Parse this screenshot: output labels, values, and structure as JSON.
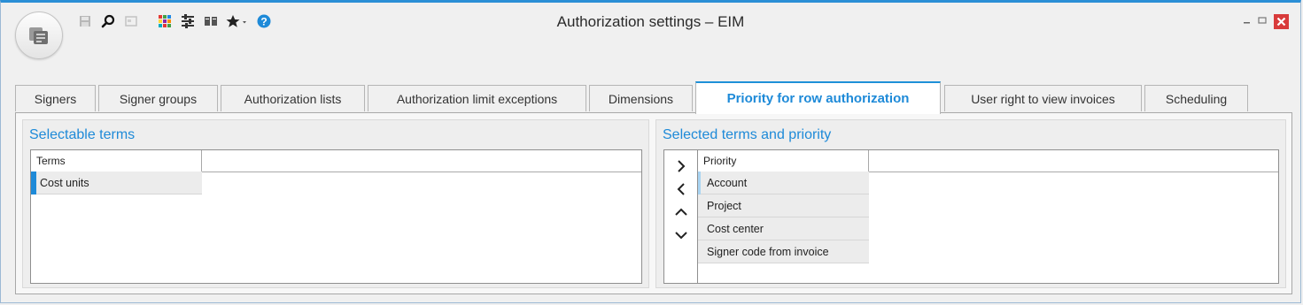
{
  "window": {
    "title": "Authorization settings – EIM",
    "accent_color": "#1e8ad8"
  },
  "toolbar": {
    "icons": [
      "save-icon",
      "search-icon",
      "document-icon",
      "color-grid-icon",
      "settings-sliders-icon",
      "book-icon",
      "star-dropdown-icon",
      "help-icon"
    ]
  },
  "window_controls": [
    "minimize-icon",
    "maximize-icon",
    "close-icon"
  ],
  "tabs": [
    {
      "label": "Signers"
    },
    {
      "label": "Signer groups"
    },
    {
      "label": "Authorization lists"
    },
    {
      "label": "Authorization limit exceptions"
    },
    {
      "label": "Dimensions"
    },
    {
      "label": "Priority for row authorization",
      "active": true
    },
    {
      "label": "User right to view invoices"
    },
    {
      "label": "Scheduling"
    }
  ],
  "selectable": {
    "title": "Selectable terms",
    "column": "Terms",
    "rows": [
      "Cost units"
    ]
  },
  "selected": {
    "title": "Selected terms and priority",
    "column": "Priority",
    "rows": [
      "Account",
      "Project",
      "Cost center",
      "Signer code from invoice"
    ],
    "buttons": [
      "move-right-icon",
      "move-left-icon",
      "move-up-icon",
      "move-down-icon"
    ]
  }
}
